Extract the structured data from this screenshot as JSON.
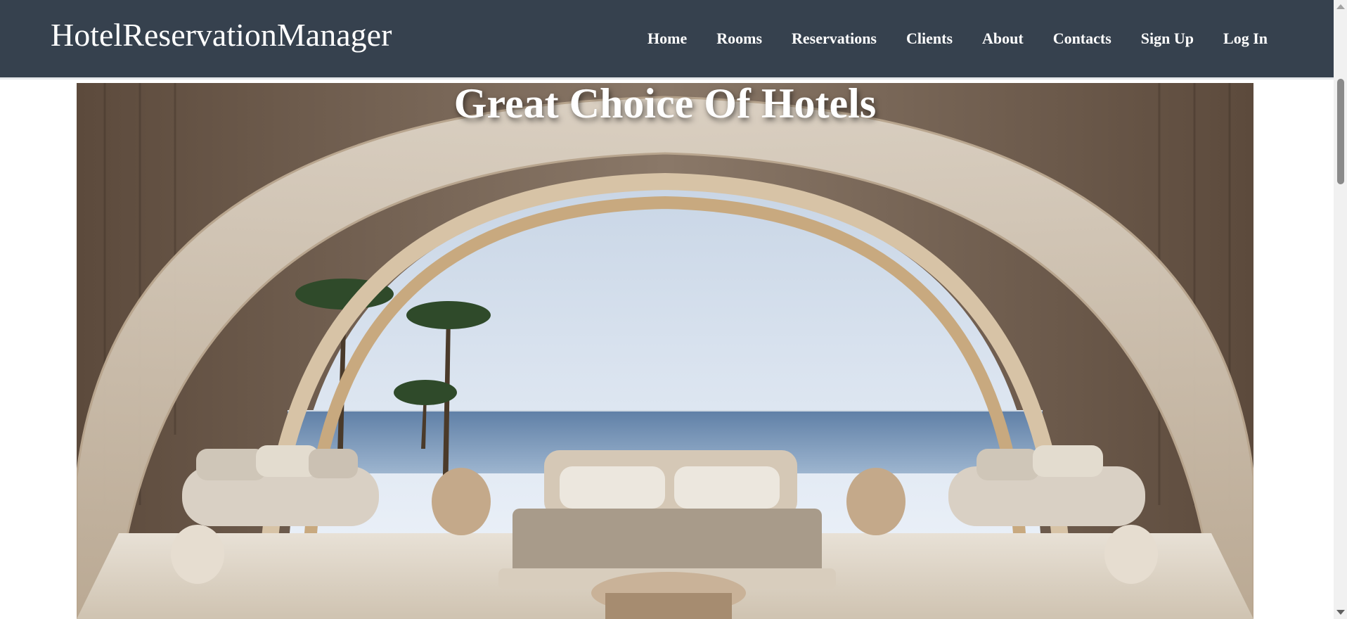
{
  "app": {
    "brand": "HotelReservationManager"
  },
  "nav": {
    "items": [
      {
        "label": "Home"
      },
      {
        "label": "Rooms"
      },
      {
        "label": "Reservations"
      },
      {
        "label": "Clients"
      },
      {
        "label": "About"
      },
      {
        "label": "Contacts"
      },
      {
        "label": "Sign Up"
      },
      {
        "label": "Log In"
      }
    ]
  },
  "hero": {
    "title": "Great Choice Of Hotels",
    "image_icon": "hotel-suite-arch-ocean-view-image"
  },
  "colors": {
    "navbar_bg": "#36414e",
    "nav_text": "#ffffff",
    "page_bg": "#ffffff"
  }
}
